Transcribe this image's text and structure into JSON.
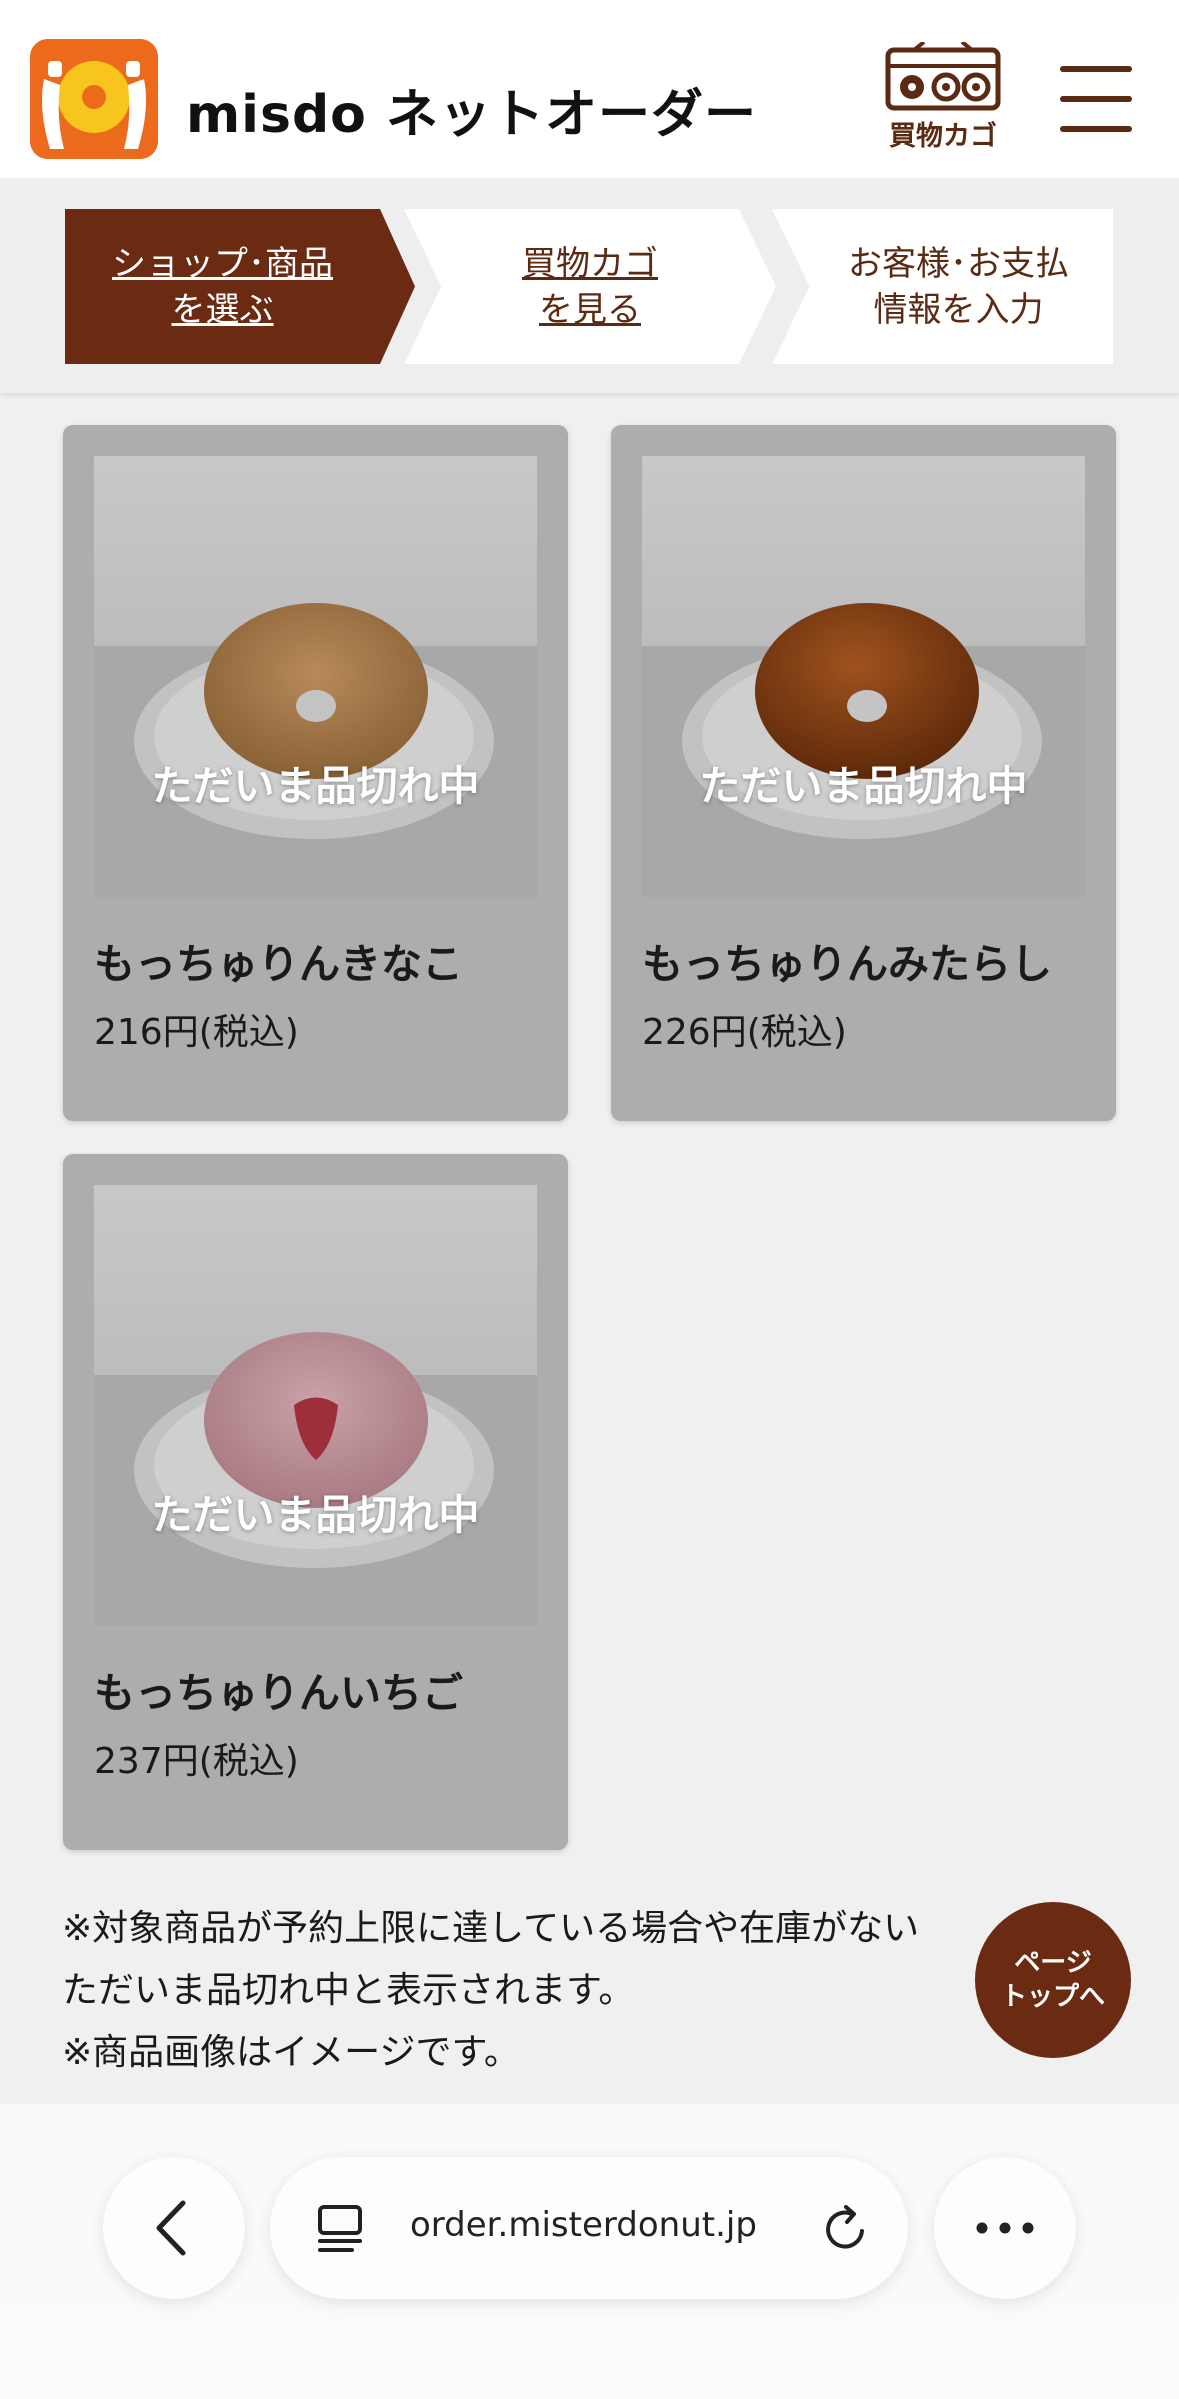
{
  "header": {
    "brand": "misdo ネットオーダー",
    "cart_label": "買物カゴ"
  },
  "steps": [
    {
      "line1": "ショップ･商品",
      "line2": "を選ぶ"
    },
    {
      "line1": "買物カゴ",
      "line2": "を見る"
    },
    {
      "line1": "お客様･お支払",
      "line2": "情報を入力"
    }
  ],
  "products": [
    {
      "name": "もっちゅりんきなこ",
      "price": "216円(税込)",
      "status": "ただいま品切れ中"
    },
    {
      "name": "もっちゅりんみたらし",
      "price": "226円(税込)",
      "status": "ただいま品切れ中"
    },
    {
      "name": "もっちゅりんいちご",
      "price": "237円(税込)",
      "status": "ただいま品切れ中"
    }
  ],
  "notes": [
    "※対象商品が予約上限に達している場合や在庫がない",
    "ただいま品切れ中と表示されます。",
    "※商品画像はイメージです。"
  ],
  "page_top": {
    "line1": "ページ",
    "line2": "トップへ"
  },
  "browser": {
    "url": "order.misterdonut.jp"
  },
  "colors": {
    "brand_brown": "#6b2a12",
    "logo_orange": "#ec6a1b",
    "card_gray": "#adadad"
  },
  "icons": {
    "cart": "radio-cart-icon",
    "menu": "hamburger-menu-icon",
    "back": "chevron-left-icon",
    "tabs": "tabs-icon",
    "reload": "reload-icon",
    "more": "more-dots-icon"
  }
}
